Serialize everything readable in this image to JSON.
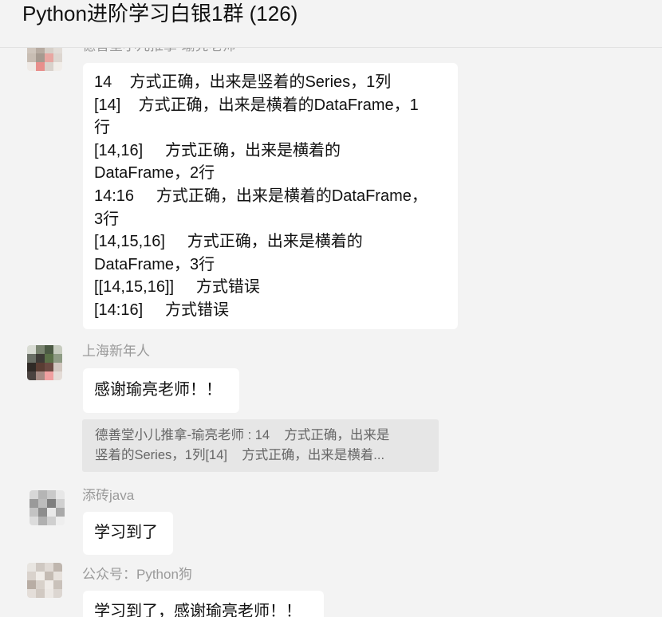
{
  "window": {
    "title": "Python进阶学习白银1群 (126)"
  },
  "messages": [
    {
      "sender": "德善堂小儿推拿-瑜亮老师",
      "lines": [
        "14    方式正确，出来是竖着的Series，1列",
        "[14]    方式正确，出来是横着的DataFrame，1",
        "行",
        "[14,16]     方式正确，出来是横着的",
        "DataFrame，2行",
        "14:16     方式正确，出来是横着的DataFrame，",
        "3行",
        "[14,15,16]     方式正确，出来是横着的",
        "DataFrame，3行",
        "[[14,15,16]]     方式错误",
        "[14:16]     方式错误"
      ]
    },
    {
      "sender": "上海新年人",
      "lines": [
        "感谢瑜亮老师！！"
      ],
      "quote": [
        "德善堂小儿推拿-瑜亮老师 : 14    方式正确，出来是",
        "竖着的Series，1列[14]    方式正确，出来是横着..."
      ]
    },
    {
      "sender": "添砖java",
      "lines": [
        "学习到了"
      ]
    },
    {
      "sender": "公众号：Python狗",
      "lines": [
        "学习到了，感谢瑜亮老师！！"
      ]
    }
  ],
  "avatar_colors": {
    "a1": [
      "#e9e4e0",
      "#d8d0c9",
      "#c9c0b8",
      "#e8e3de",
      "#cfc5bc",
      "#b7aba1",
      "#d6cfc8",
      "#e2ddd8",
      "#c8bdb3",
      "#a69a90",
      "#e8a7a2",
      "#ddd6d0",
      "#efeae6",
      "#e88f8c",
      "#d9d2cc",
      "#f1ede9"
    ],
    "a2": [
      "#d9dcd4",
      "#7a8470",
      "#4c5a44",
      "#c7ccbf",
      "#6a6f66",
      "#3d3a36",
      "#5a7048",
      "#8e9b84",
      "#2f2a26",
      "#5a3d33",
      "#6b4a42",
      "#d2c7c0",
      "#4a4340",
      "#a68b84",
      "#f0a0a0",
      "#e4dcd7"
    ],
    "a3": [
      "#d7d7d7",
      "#b5b5b5",
      "#c9c9c9",
      "#e7e7e7",
      "#9a9a9a",
      "#bdbdbd",
      "#7f7f7f",
      "#d0d0d0",
      "#c3c3c3",
      "#8d8d8d",
      "#e9e9e9",
      "#a9a9a9",
      "#dcdcdc",
      "#b0b0b0",
      "#cfcfcf",
      "#eeeeee"
    ],
    "a4": [
      "#e8e5e1",
      "#cfc8c2",
      "#e0dad5",
      "#bfb6ae",
      "#d9d2cc",
      "#f0ece8",
      "#c4bbb3",
      "#e7e1dc",
      "#b8ada4",
      "#d8d1ca",
      "#efebe7",
      "#c9c1ba",
      "#e4ded9",
      "#d1c9c2",
      "#ece8e4",
      "#dcd6d1"
    ]
  }
}
